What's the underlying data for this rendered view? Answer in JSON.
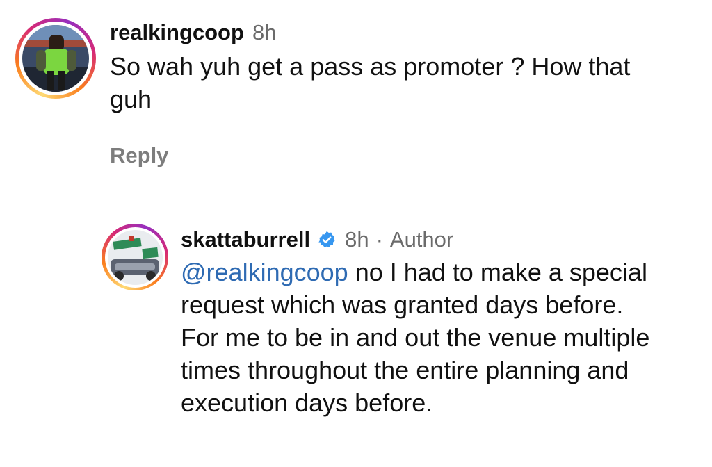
{
  "comments": [
    {
      "username": "realkingcoop",
      "time": "8h",
      "text": "So wah yuh get a pass as promoter ? How that guh",
      "reply_label": "Reply"
    }
  ],
  "reply": {
    "username": "skattaburrell",
    "time": "8h",
    "separator": "·",
    "author_label": "Author",
    "mention": "@realkingcoop",
    "text": " no I had to make a special request which was granted days before. For me to be in and out the venue multiple times throughout the entire planning and execution days before."
  },
  "colors": {
    "mention": "#2f6bb3",
    "verified": "#3797f0",
    "muted": "#6b6b6b"
  },
  "icons": {
    "verified": "verified-badge-icon"
  }
}
